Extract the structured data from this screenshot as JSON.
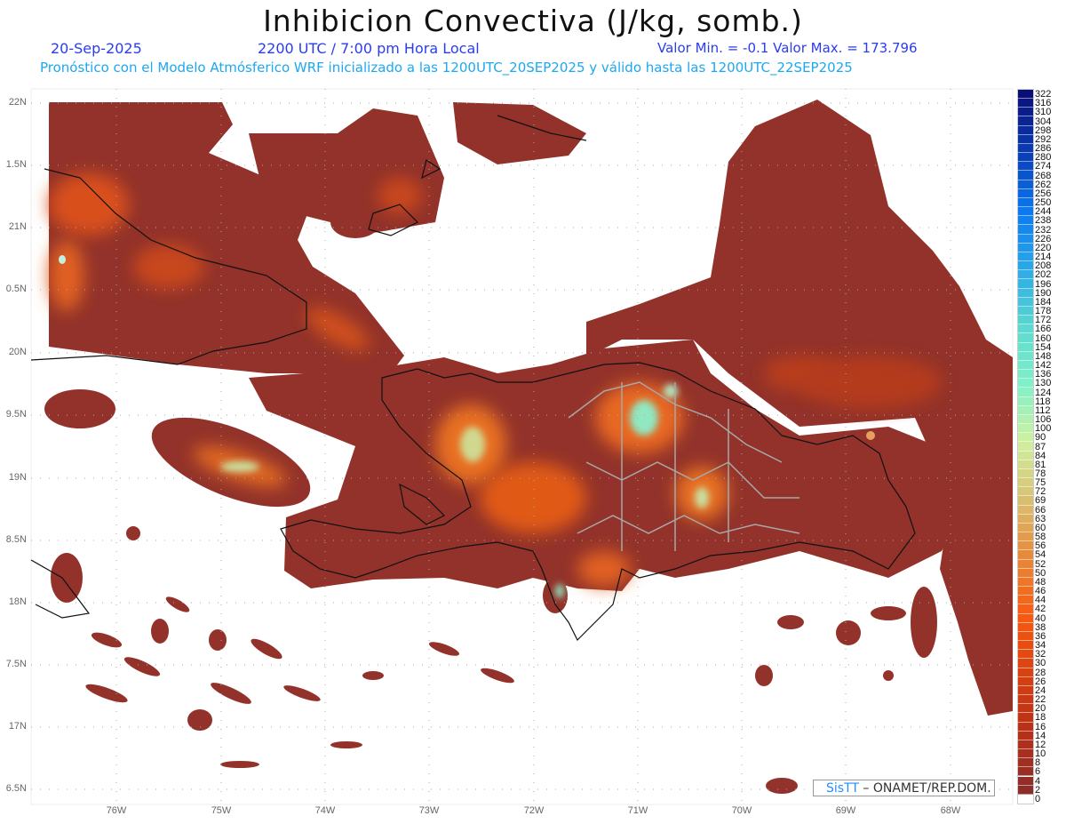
{
  "header": {
    "title": "Inhibicion Convectiva (J/kg, somb.)",
    "date": "20-Sep-2025",
    "time": "2200 UTC / 7:00 pm Hora Local",
    "minmax": "Valor Min. = -0.1  Valor Max. = 173.796",
    "forecast_note": "Pronóstico con el Modelo Atmósferico WRF inicializado a las 1200UTC_20SEP2025 y válido hasta las  1200UTC_22SEP2025"
  },
  "map": {
    "lat_labels": [
      "22N",
      "1.5N",
      "21N",
      "0.5N",
      "20N",
      "9.5N",
      "19N",
      "8.5N",
      "18N",
      "7.5N",
      "17N",
      "6.5N"
    ],
    "lon_labels": [
      "76W",
      "75W",
      "74W",
      "73W",
      "72W",
      "71W",
      "70W",
      "69W",
      "68W"
    ]
  },
  "colorbar": {
    "labels": [
      "322",
      "316",
      "310",
      "304",
      "298",
      "292",
      "286",
      "280",
      "274",
      "268",
      "262",
      "256",
      "250",
      "244",
      "238",
      "232",
      "226",
      "220",
      "214",
      "208",
      "202",
      "196",
      "190",
      "184",
      "178",
      "172",
      "166",
      "160",
      "154",
      "148",
      "142",
      "136",
      "130",
      "124",
      "118",
      "112",
      "106",
      "100",
      "90",
      "87",
      "84",
      "81",
      "78",
      "75",
      "72",
      "69",
      "66",
      "63",
      "60",
      "58",
      "56",
      "54",
      "52",
      "50",
      "48",
      "46",
      "44",
      "42",
      "40",
      "38",
      "36",
      "34",
      "32",
      "30",
      "28",
      "26",
      "24",
      "22",
      "20",
      "18",
      "16",
      "14",
      "12",
      "10",
      "8",
      "6",
      "4",
      "2",
      "0"
    ],
    "color_stops": [
      "#0a0f78",
      "#0a3cb4",
      "#0a78f0",
      "#2aa8e8",
      "#5ad8d0",
      "#80f0c8",
      "#d0f0a0",
      "#d8c070",
      "#e88838",
      "#f85a10",
      "#d84010",
      "#b83018",
      "#8b2e2a",
      "#ffffff"
    ]
  },
  "credit": {
    "brand": "SisTT",
    "text": " – ONAMET/REP.DOM."
  }
}
